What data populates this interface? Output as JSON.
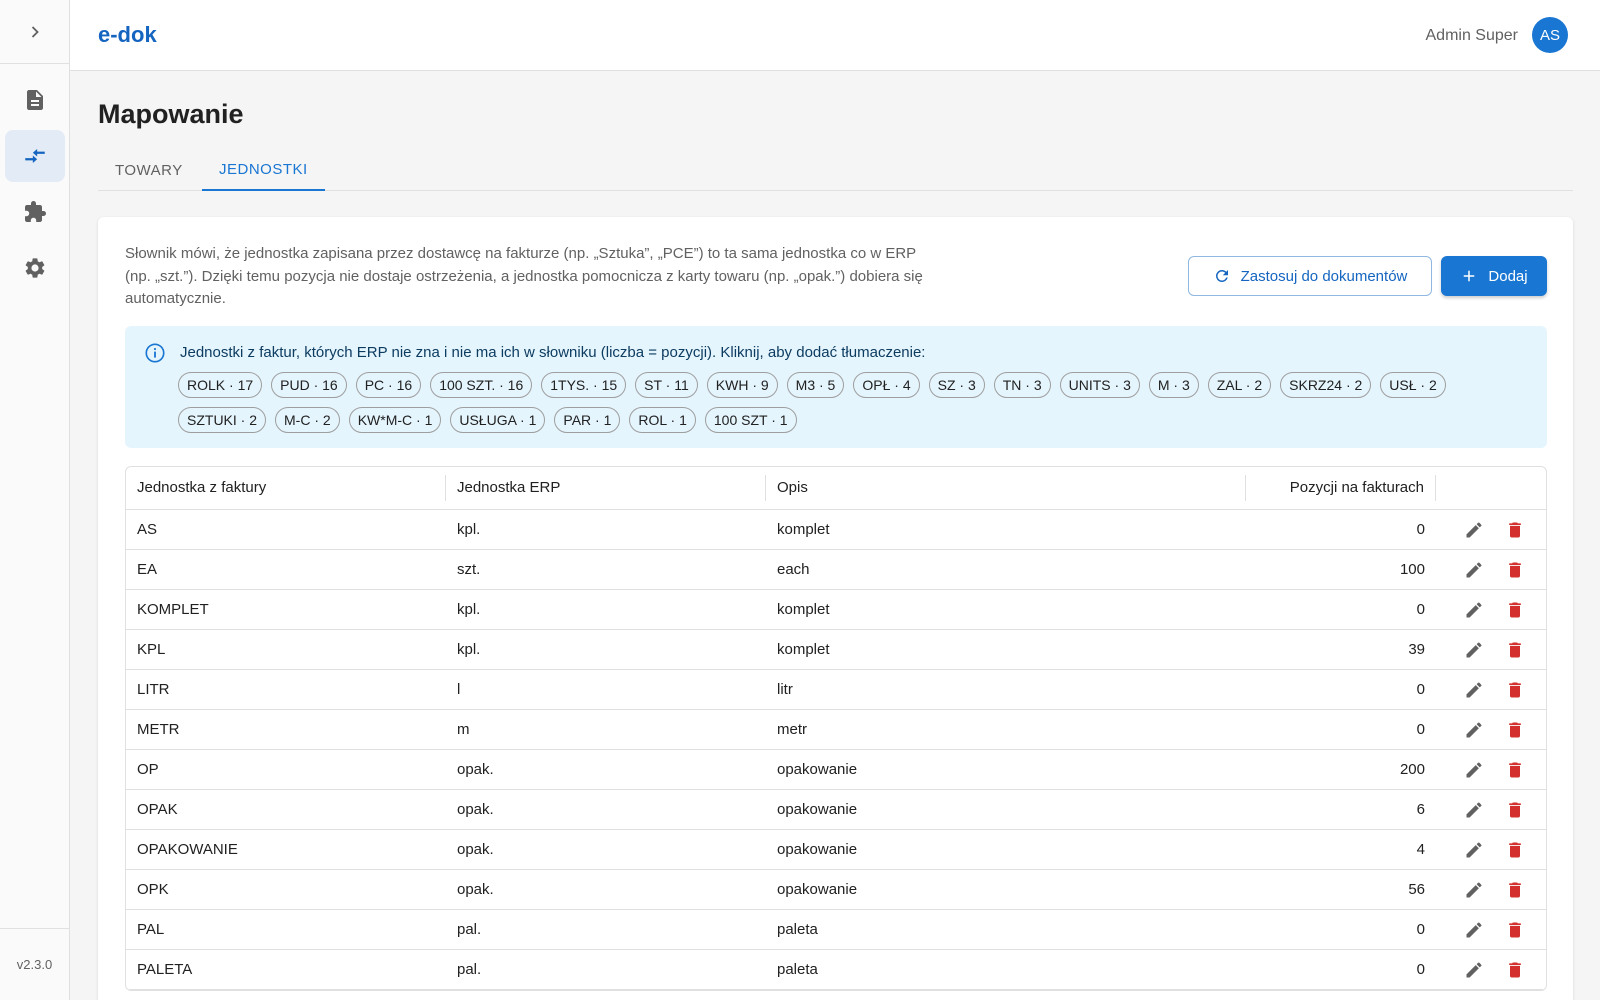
{
  "app": {
    "logo": "e-dok",
    "version": "v2.3.0"
  },
  "user": {
    "name": "Admin Super",
    "initials": "AS"
  },
  "sidebar": {
    "items": [
      {
        "icon": "document-icon"
      },
      {
        "icon": "mapping-arrows-icon",
        "active": true
      },
      {
        "icon": "puzzle-icon"
      },
      {
        "icon": "gear-icon"
      }
    ]
  },
  "page": {
    "title": "Mapowanie"
  },
  "tabs": [
    {
      "label": "TOWARY",
      "active": false
    },
    {
      "label": "JEDNOSTKI",
      "active": true
    }
  ],
  "description": "Słownik mówi, że jednostka zapisana przez dostawcę na fakturze (np. „Sztuka”, „PCE”) to ta sama jednostka co w ERP (np. „szt.”). Dzięki temu pozycja nie dostaje ostrzeżenia, a jednostka pomocnicza z karty towaru (np. „opak.”) dobiera się automatycznie.",
  "buttons": {
    "apply": "Zastosuj do dokumentów",
    "add": "Dodaj"
  },
  "info": {
    "text": "Jednostki z faktur, których ERP nie zna i nie ma ich w słowniku (liczba = pozycji). Kliknij, aby dodać tłumaczenie:",
    "chips": [
      "ROLK · 17",
      "PUD · 16",
      "PC · 16",
      "100 SZT. · 16",
      "1TYS. · 15",
      "ST · 11",
      "KWH · 9",
      "M3 · 5",
      "OPŁ · 4",
      "SZ · 3",
      "TN · 3",
      "UNITS · 3",
      "M · 3",
      "ZAL · 2",
      "SKRZ24 · 2",
      "USŁ · 2",
      "SZTUKI · 2",
      "M-C · 2",
      "KW*M-C · 1",
      "USŁUGA · 1",
      "PAR · 1",
      "ROL · 1",
      "100 SZT · 1"
    ]
  },
  "table": {
    "headers": [
      "Jednostka z faktury",
      "Jednostka ERP",
      "Opis",
      "Pozycji na fakturach"
    ],
    "rows": [
      {
        "invoice_unit": "AS",
        "erp_unit": "kpl.",
        "desc": "komplet",
        "count": "0"
      },
      {
        "invoice_unit": "EA",
        "erp_unit": "szt.",
        "desc": "each",
        "count": "100"
      },
      {
        "invoice_unit": "KOMPLET",
        "erp_unit": "kpl.",
        "desc": "komplet",
        "count": "0"
      },
      {
        "invoice_unit": "KPL",
        "erp_unit": "kpl.",
        "desc": "komplet",
        "count": "39"
      },
      {
        "invoice_unit": "LITR",
        "erp_unit": "l",
        "desc": "litr",
        "count": "0"
      },
      {
        "invoice_unit": "METR",
        "erp_unit": "m",
        "desc": "metr",
        "count": "0"
      },
      {
        "invoice_unit": "OP",
        "erp_unit": "opak.",
        "desc": "opakowanie",
        "count": "200"
      },
      {
        "invoice_unit": "OPAK",
        "erp_unit": "opak.",
        "desc": "opakowanie",
        "count": "6"
      },
      {
        "invoice_unit": "OPAKOWANIE",
        "erp_unit": "opak.",
        "desc": "opakowanie",
        "count": "4"
      },
      {
        "invoice_unit": "OPK",
        "erp_unit": "opak.",
        "desc": "opakowanie",
        "count": "56"
      },
      {
        "invoice_unit": "PAL",
        "erp_unit": "pal.",
        "desc": "paleta",
        "count": "0"
      },
      {
        "invoice_unit": "PALETA",
        "erp_unit": "pal.",
        "desc": "paleta",
        "count": "0"
      }
    ]
  },
  "colors": {
    "primary": "#1976d2",
    "delete": "#d32f2f",
    "info_bg": "#e5f5fd"
  }
}
